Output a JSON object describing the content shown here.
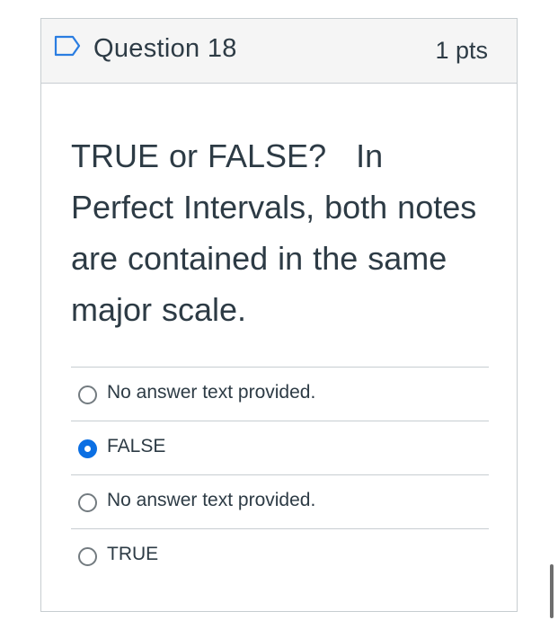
{
  "question": {
    "title": "Question 18",
    "points": "1 pts",
    "text": "TRUE or FALSE?   In Perfect Intervals, both notes are contained in the same major scale.",
    "flag_icon": "flag-outline-icon"
  },
  "answers": [
    {
      "label": "No answer text provided.",
      "selected": false
    },
    {
      "label": "FALSE",
      "selected": true
    },
    {
      "label": "No answer text provided.",
      "selected": false
    },
    {
      "label": "TRUE",
      "selected": false
    }
  ],
  "colors": {
    "accent": "#0b6fe3",
    "text": "#2d3b45",
    "border": "#c7cdd1",
    "header_bg": "#f5f5f5"
  }
}
